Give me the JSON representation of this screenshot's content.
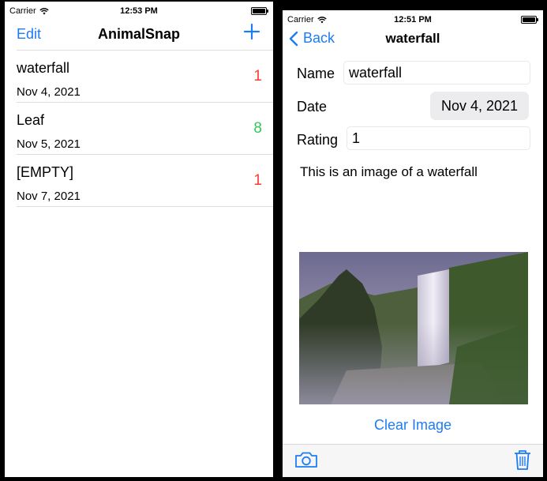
{
  "colors": {
    "accent": "#1e7cf2",
    "rating_low": "#ff3b30",
    "rating_high": "#34c759"
  },
  "left": {
    "status": {
      "carrier": "Carrier",
      "time": "12:53 PM"
    },
    "nav": {
      "edit": "Edit",
      "title": "AnimalSnap",
      "add_icon": "plus-icon"
    },
    "items": [
      {
        "title": "waterfall",
        "date": "Nov 4, 2021",
        "rating": "1",
        "rating_color": "#ff3b30"
      },
      {
        "title": "Leaf",
        "date": "Nov 5, 2021",
        "rating": "8",
        "rating_color": "#34c759"
      },
      {
        "title": "[EMPTY]",
        "date": "Nov 7, 2021",
        "rating": "1",
        "rating_color": "#ff3b30"
      }
    ]
  },
  "right": {
    "status": {
      "carrier": "Carrier",
      "time": "12:51 PM"
    },
    "nav": {
      "back": "Back",
      "title": "waterfall"
    },
    "form": {
      "name_label": "Name",
      "name_value": "waterfall",
      "date_label": "Date",
      "date_value": "Nov 4, 2021",
      "rating_label": "Rating",
      "rating_value": "1"
    },
    "description": "This is an image of a waterfall",
    "clear_button": "Clear Image",
    "toolbar": {
      "left_icon": "camera-icon",
      "right_icon": "trash-icon"
    }
  }
}
